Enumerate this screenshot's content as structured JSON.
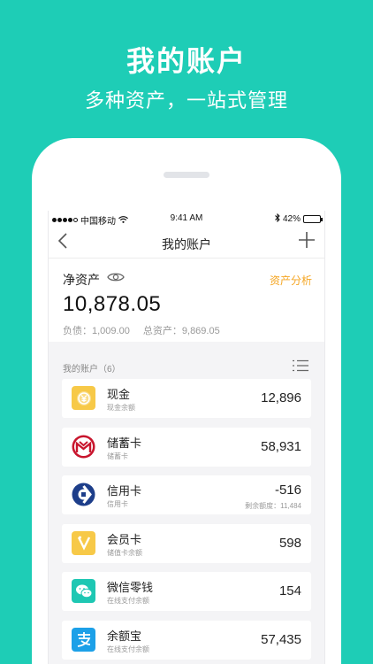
{
  "promo": {
    "title": "我的账户",
    "subtitle": "多种资产，一站式管理"
  },
  "status_bar": {
    "carrier": "中国移动",
    "time": "9:41 AM",
    "battery": "42%",
    "battery_level": 0.42
  },
  "nav": {
    "title": "我的账户",
    "back_icon": "chevron-left-icon",
    "add_icon": "plus-icon"
  },
  "summary": {
    "net_assets_label": "净资产",
    "net_assets_value": "10,878.05",
    "analysis_link": "资产分析",
    "debt": "负债：1,009.00",
    "total_assets": "总资产：9,869.05"
  },
  "accounts": {
    "header": "我的账户（6）",
    "items": [
      {
        "name": "现金",
        "subtitle": "现金余额",
        "amount": "12,896",
        "icon": "cash-icon",
        "color": "#F7C948"
      },
      {
        "name": "储蓄卡",
        "subtitle": "储蓄卡",
        "amount": "58,931",
        "icon": "bank-card-icon",
        "color": "#C8152D"
      },
      {
        "name": "信用卡",
        "subtitle": "信用卡",
        "amount": "-516",
        "limit": "剩余额度：11,484",
        "icon": "credit-card-icon",
        "color": "#1D3E8A"
      },
      {
        "name": "会员卡",
        "subtitle": "储值卡余额",
        "amount": "598",
        "icon": "member-card-icon",
        "color": "#F7C948"
      },
      {
        "name": "微信零钱",
        "subtitle": "在线支付余额",
        "amount": "154",
        "icon": "wechat-icon",
        "color": "#1EC7B3"
      },
      {
        "name": "余额宝",
        "subtitle": "在线支付余额",
        "amount": "57,435",
        "icon": "alipay-icon",
        "color": "#1CA0E8"
      }
    ]
  },
  "colors": {
    "background": "#1ECDB6",
    "accent": "#F5A623"
  }
}
